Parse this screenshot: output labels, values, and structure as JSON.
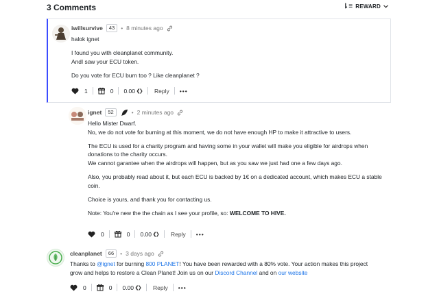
{
  "header": {
    "title": "3 Comments",
    "sort_label": "REWARD"
  },
  "comments": [
    {
      "author": "iwillsurvive",
      "reputation": "43",
      "time": "8 minutes ago",
      "body": [
        "halok ignet",
        "I found you with cleanplanet community.",
        "AndI saw your ECU token.",
        "Do you vote for ECU burn too ? Like cleanplanet ?"
      ],
      "votes": "1",
      "gifts": "0",
      "payout": "0.00",
      "reply_label": "Reply",
      "more_label": "•••"
    },
    {
      "author": "ignet",
      "reputation": "52",
      "time": "2 minutes ago",
      "body": [
        "Hello Mister Dwarf.",
        "No, we do not vote for burning at this moment, we do not have enough HP to make it attractive to users.",
        "The ECU is used for a charity program and having some in your wallet will make you eligible for airdrops when donations to the charity occurs.",
        "We cannot garantee when the airdrops will happen, but as you saw we just had one a few days ago.",
        "Also, you probably read about it, but each ECU is backed by 1€ on a dedicated account, which makes ECU a stable coin.",
        "Choice is yours, and thank you for contacting us.",
        "Note: You're new the the chain as I see your profile, so:",
        "WELCOME TO HIVE."
      ],
      "votes": "0",
      "gifts": "0",
      "payout": "0.00",
      "reply_label": "Reply",
      "more_label": "•••"
    },
    {
      "author": "cleanplanet",
      "reputation": "66",
      "time": "3 days ago",
      "body": {
        "t1": "Thanks to ",
        "mention": "@ignet",
        "t2": " for burning ",
        "amount": "800 PLANET",
        "t3": "! You have been rewarded with a 80% vote. Your action makes this project grow and helps to restore a Clean Planet! Join us on our ",
        "link1": "Discord Channel",
        "t4": " and on ",
        "link2": "our website"
      },
      "votes": "0",
      "gifts": "0",
      "payout": "0.00",
      "reply_label": "Reply",
      "more_label": "•••"
    }
  ],
  "colors": {
    "accent_border": "#3b4cff",
    "link": "#1a73e8",
    "text": "#212529"
  },
  "icons": [
    "sort-icon",
    "chevron-down-icon",
    "link-icon",
    "feather-icon",
    "heart-icon",
    "gift-icon",
    "hive-icon"
  ]
}
